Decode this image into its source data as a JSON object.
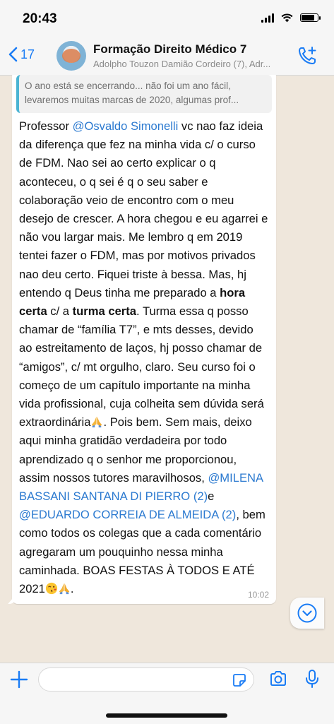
{
  "status_bar": {
    "time": "20:43"
  },
  "header": {
    "back_count": "17",
    "title": "Formação Direito Médico 7",
    "subtitle": "Adolpho Touzon Damião Cordeiro (7), Adr..."
  },
  "quote": {
    "line1": "O ano está se encerrando... não foi um ano fácil,",
    "line2": "levaremos muitas marcas de 2020, algumas prof..."
  },
  "message": {
    "p1": "Professor ",
    "mention1": "@Osvaldo Simonelli",
    "p2": " vc nao faz ideia da diferença que fez na minha vida c/ o curso de FDM. Nao sei ao certo explicar o q aconteceu, o q sei é q o seu saber e colaboração veio de encontro com o meu desejo de crescer. A hora chegou e eu agarrei e não vou largar mais. Me lembro q em 2019 tentei fazer o FDM, mas por motivos privados nao deu certo. Fiquei triste à bessa. Mas, hj entendo q Deus tinha me preparado a ",
    "bold1": "hora certa",
    "p3": " c/ a ",
    "bold2": "turma certa",
    "p4": ". Turma essa q posso chamar de “família T7”, e mts desses, devido ao estreitamento de laços, hj posso chamar de “amigos”, c/ mt orgulho, claro. Seu curso foi o começo de um capítulo importante na minha vida profissional, cuja colheita sem dúvida será extraordinária",
    "p5": ". Pois bem. Sem mais, deixo aqui minha gratidão verdadeira por todo aprendizado q o senhor me proporcionou, assim nossos tutores maravilhosos, ",
    "mention2": "@MILENA BASSANI SANTANA DI PIERRO (2)",
    "p6": "e ",
    "mention3": "@EDUARDO CORREIA DE ALMEIDA (2)",
    "p7": ", bem como todos os colegas que a cada comentário agregaram um pouquinho nessa minha caminhada. BOAS FESTAS À TODOS E ATÉ 2021",
    "p8": ".",
    "time": "10:02"
  },
  "composer": {
    "placeholder": ""
  },
  "colors": {
    "accent": "#1a7cf5",
    "mention": "#2c7ad0",
    "chat_bg": "#efe7dc",
    "quote_bar": "#4bb4d3"
  },
  "icons": [
    "chevron-left-icon",
    "add-participant-call-icon",
    "chevron-down-icon",
    "plus-icon",
    "sticker-icon",
    "camera-icon",
    "microphone-icon",
    "praying-hands-emoji",
    "wink-kiss-emoji"
  ]
}
